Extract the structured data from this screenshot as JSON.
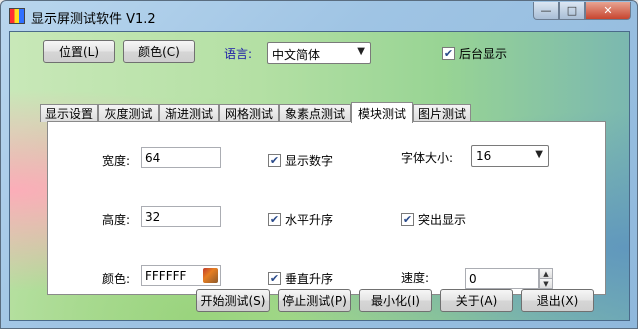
{
  "window": {
    "title": "显示屏测试软件 V1.2"
  },
  "titlebar": {
    "minimize": "—",
    "maximize": "□",
    "close": "✕"
  },
  "top": {
    "position_button": "位置(L)",
    "color_button": "颜色(C)",
    "language_label": "语言:",
    "language_value": "中文简体",
    "background_display": "后台显示"
  },
  "tabs": [
    "显示设置",
    "灰度测试",
    "渐进测试",
    "网格测试",
    "象素点测试",
    "模块测试",
    "图片测试"
  ],
  "active_tab": "模块测试",
  "panel": {
    "width_label": "宽度:",
    "width_value": "64",
    "height_label": "高度:",
    "height_value": "32",
    "color_label": "颜色:",
    "color_value": "FFFFFF",
    "show_number": "显示数字",
    "horizontal_asc": "水平升序",
    "vertical_asc": "垂直升序",
    "font_size_label": "字体大小:",
    "font_size_value": "16",
    "highlight": "突出显示",
    "speed_label": "速度:",
    "speed_value": "0"
  },
  "bottom": {
    "start": "开始测试(S)",
    "stop": "停止测试(P)",
    "minimize": "最小化(I)",
    "about": "关于(A)",
    "exit": "退出(X)"
  },
  "checkbox_states": {
    "background_display": true,
    "show_number": true,
    "horizontal_asc": true,
    "vertical_asc": true,
    "highlight": true
  }
}
